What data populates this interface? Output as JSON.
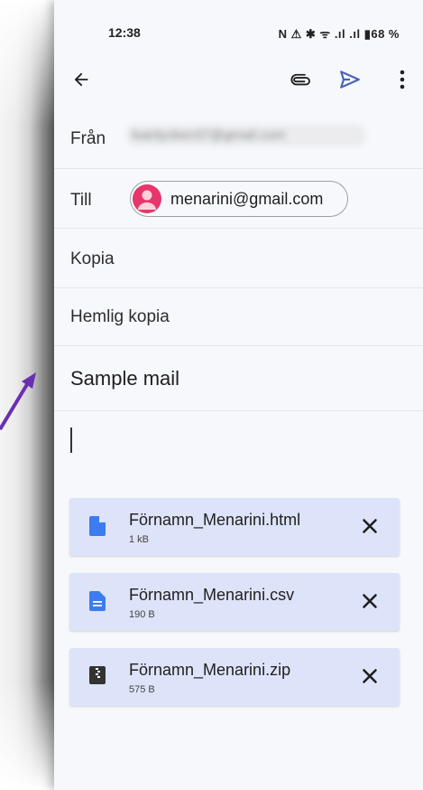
{
  "status_bar": {
    "time": "12:38",
    "icons_text": "N ⚠ ✱ ᯤ .ıl .ıl ▮68 %"
  },
  "toolbar": {
    "back_icon": "arrow-back-icon",
    "attach_icon": "paperclip-icon",
    "send_icon": "send-icon",
    "more_icon": "more-vert-icon",
    "accent_color": "#4a62b5"
  },
  "compose": {
    "from_label": "Från",
    "from_value": "lsanlycken37@gmail.com",
    "to_label": "Till",
    "to_chip": "menarini@gmail.com",
    "cc_label": "Kopia",
    "bcc_label": "Hemlig kopia",
    "subject": "Sample mail"
  },
  "attachments": [
    {
      "name": "Förnamn_Menarini.html",
      "size": "1 kB",
      "icon": "file-icon",
      "icon_color": "#3c7cf0"
    },
    {
      "name": "Förnamn_Menarini.csv",
      "size": "190 B",
      "icon": "document-icon",
      "icon_color": "#3c7cf0"
    },
    {
      "name": "Förnamn_Menarini.zip",
      "size": "575 B",
      "icon": "archive-icon",
      "icon_color": "#333333"
    }
  ]
}
